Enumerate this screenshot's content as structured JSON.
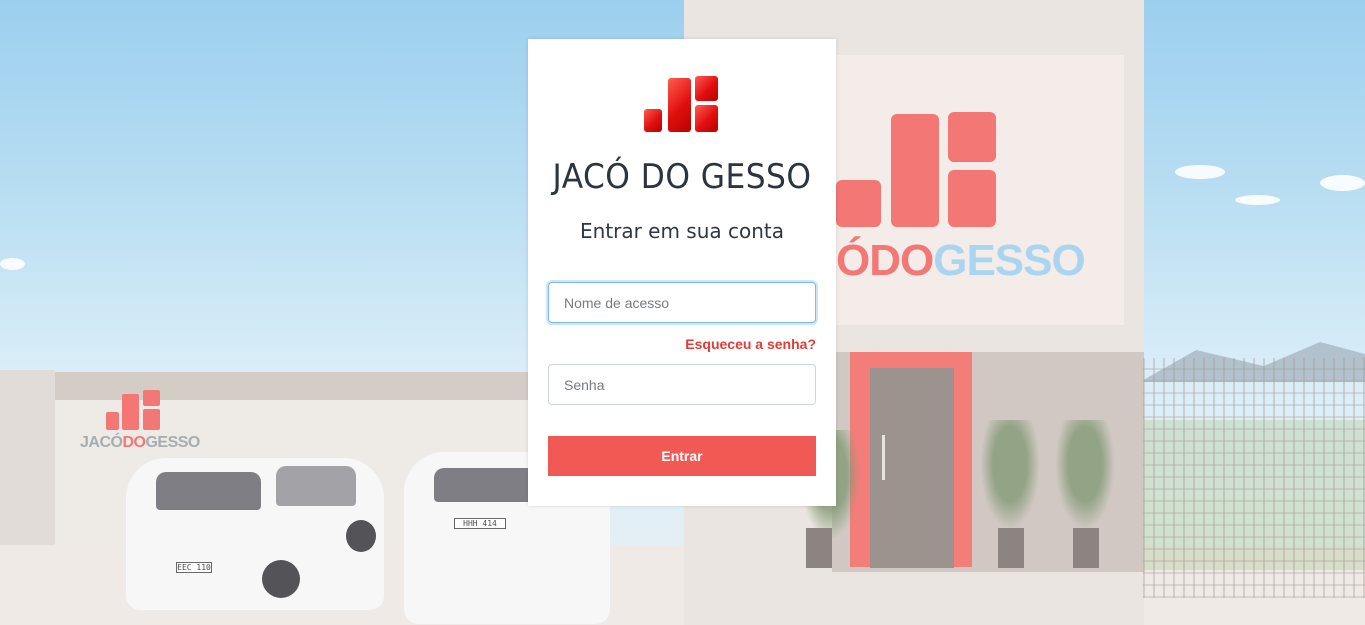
{
  "background": {
    "sign_text_left": "JACÓ",
    "sign_text_mid": "DO",
    "sign_text_right": "GESSO",
    "wall_sign_left": "JACÓ",
    "wall_sign_mid": "DO",
    "wall_sign_right": "GESSO",
    "car1_plate": "EEC 110",
    "car2_plate": "HHH 414",
    "colors": {
      "brand_red": "#f26561",
      "sign_blue": "#9fd0f0"
    }
  },
  "login": {
    "brand_title": "JACÓ DO GESSO",
    "subtitle": "Entrar em sua conta",
    "username_placeholder": "Nome de acesso",
    "username_value": "",
    "forgot_label": "Esqueceu a senha?",
    "password_placeholder": "Senha",
    "password_value": "",
    "submit_label": "Entrar",
    "colors": {
      "accent": "#f15a54",
      "link": "#e13c36",
      "title": "#2b3440"
    },
    "logo_icon": "bar-chart-logo-icon"
  }
}
